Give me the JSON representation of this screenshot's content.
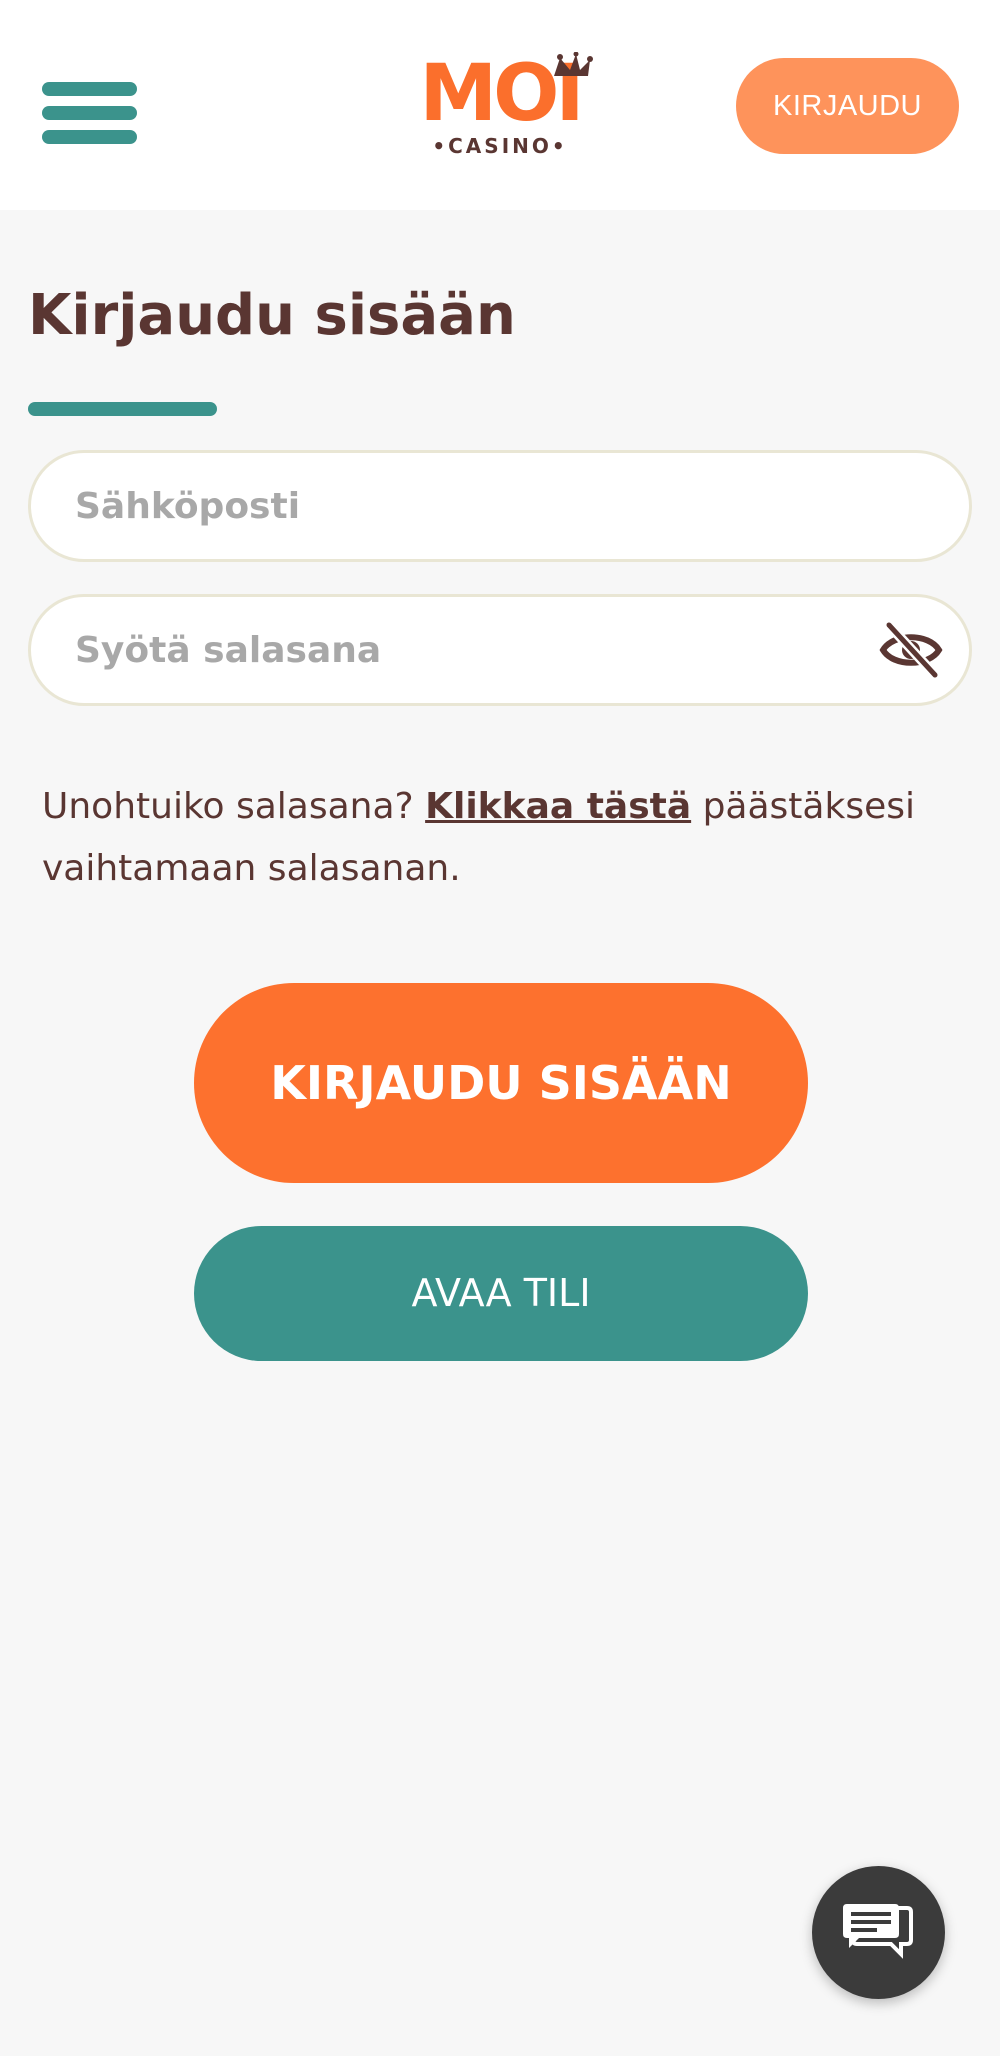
{
  "header": {
    "menu_icon": "hamburger-menu-icon",
    "logo": {
      "main": "MOI",
      "sub": "•CASINO•",
      "hat_icon": "jester-hat-icon"
    },
    "login_label": "KIRJAUDU"
  },
  "main": {
    "title": "Kirjaudu sisään",
    "email_placeholder": "Sähköposti",
    "email_value": "",
    "password_placeholder": "Syötä salasana",
    "password_value": "",
    "password_toggle_icon": "eye-slash-icon",
    "forgot_text_before": "Unohtuiko salasana? ",
    "forgot_link": "Klikkaa tästä",
    "forgot_text_after": " päästäksesi vaihtamaan salasanan.",
    "login_button": "KIRJAUDU SISÄÄN",
    "open_account_button": "AVAA TILI"
  },
  "chat": {
    "icon": "chat-bubbles-icon"
  },
  "colors": {
    "teal": "#3b938c",
    "orange": "#fd712e",
    "light_orange": "#fe935b",
    "text_brown": "#5a3632",
    "background": "#f7f7f7"
  }
}
